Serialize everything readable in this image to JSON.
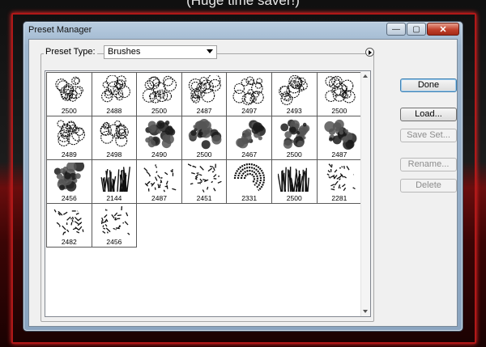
{
  "background": {
    "caption": "(Huge time saver!)"
  },
  "window": {
    "title": "Preset Manager",
    "controls": {
      "minimize": "—",
      "maximize": "▢",
      "close": "✕"
    }
  },
  "preset": {
    "label": "Preset Type:",
    "value": "Brushes"
  },
  "buttons": {
    "done": "Done",
    "load": "Load...",
    "save_set": "Save Set...",
    "rename": "Rename...",
    "delete": "Delete"
  },
  "brushes": [
    {
      "size": "2500",
      "kind": "tree"
    },
    {
      "size": "2488",
      "kind": "tree"
    },
    {
      "size": "2500",
      "kind": "tree"
    },
    {
      "size": "2487",
      "kind": "tree"
    },
    {
      "size": "2497",
      "kind": "tree"
    },
    {
      "size": "2493",
      "kind": "tree"
    },
    {
      "size": "2500",
      "kind": "tree"
    },
    {
      "size": "2489",
      "kind": "tree"
    },
    {
      "size": "2498",
      "kind": "tree"
    },
    {
      "size": "2490",
      "kind": "dark"
    },
    {
      "size": "2500",
      "kind": "dark"
    },
    {
      "size": "2467",
      "kind": "dark"
    },
    {
      "size": "2500",
      "kind": "dark"
    },
    {
      "size": "2487",
      "kind": "dark"
    },
    {
      "size": "2456",
      "kind": "dark"
    },
    {
      "size": "2144",
      "kind": "grass"
    },
    {
      "size": "2487",
      "kind": "scribble"
    },
    {
      "size": "2451",
      "kind": "scribble"
    },
    {
      "size": "2331",
      "kind": "swirl"
    },
    {
      "size": "2500",
      "kind": "grass"
    },
    {
      "size": "2281",
      "kind": "scribble"
    },
    {
      "size": "2482",
      "kind": "scribble"
    },
    {
      "size": "2456",
      "kind": "scribble"
    }
  ]
}
